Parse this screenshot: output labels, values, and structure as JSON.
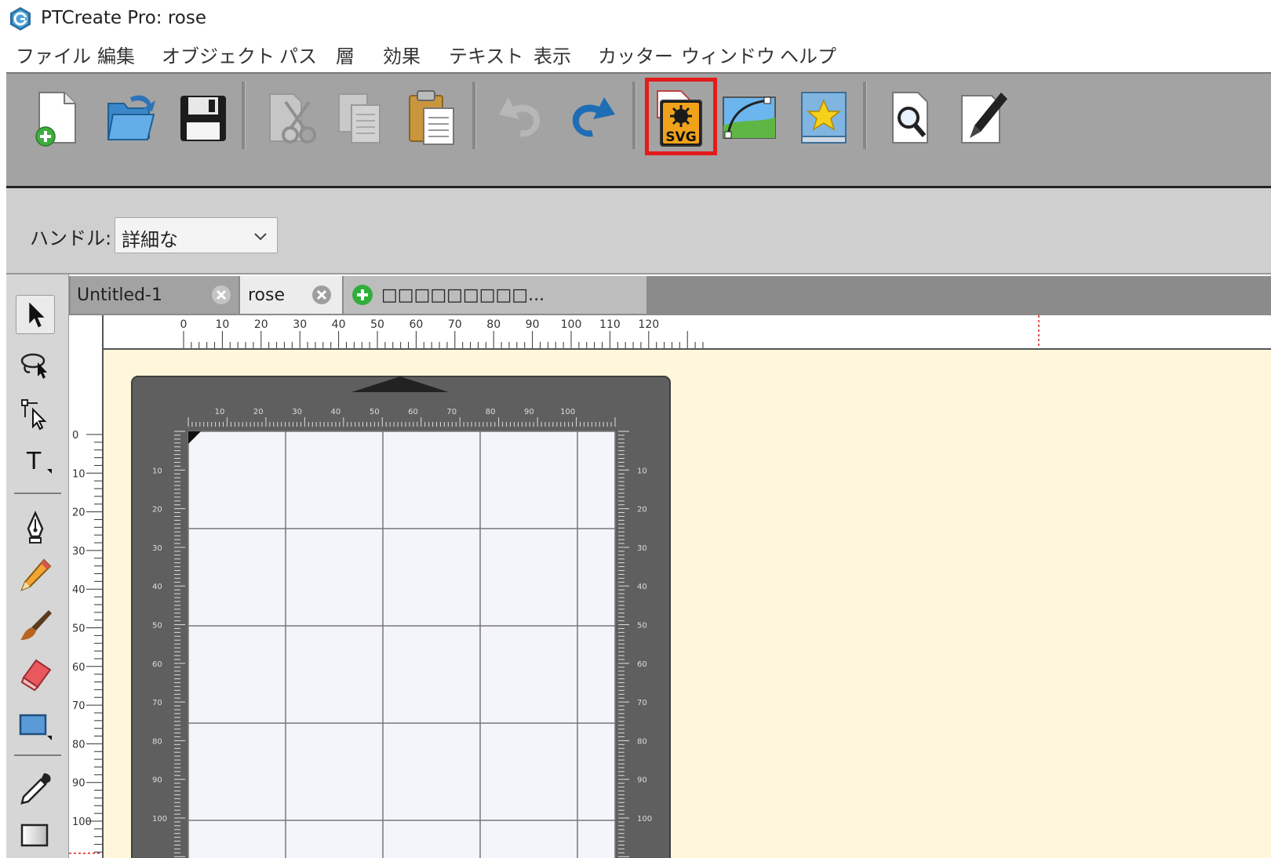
{
  "window": {
    "title": "PTCreate Pro: rose"
  },
  "menu": [
    "ファイル",
    "編集",
    "オブジェクト",
    "パス",
    "層",
    "効果",
    "テキスト",
    "表示",
    "カッター",
    "ウィンドウ",
    "ヘルプ"
  ],
  "toolbar": {
    "buttons": [
      "new-document",
      "open",
      "save",
      "cut",
      "copy",
      "paste",
      "undo",
      "redo",
      "import-svg",
      "trace-image",
      "library",
      "preview",
      "cut-to-cutter"
    ],
    "highlighted": "import-svg",
    "svg_label": "SVG"
  },
  "properties": {
    "handle_label": "ハンドル:",
    "handle_value": "詳細な"
  },
  "tabs": [
    {
      "label": "Untitled-1",
      "active": false
    },
    {
      "label": "rose",
      "active": true
    },
    {
      "label": "□□□□□□□□□...",
      "active": false
    }
  ],
  "rulers": {
    "top_labels": [
      "0",
      "10",
      "20",
      "30",
      "40",
      "50",
      "60",
      "70",
      "80",
      "90",
      "100",
      "110",
      "120"
    ],
    "left_labels": [
      "0",
      "10",
      "20",
      "30",
      "40",
      "50",
      "60",
      "70",
      "80",
      "90",
      "100"
    ]
  },
  "mat": {
    "top_labels": [
      "10",
      "20",
      "30",
      "40",
      "50",
      "60",
      "70",
      "80",
      "90",
      "100"
    ],
    "side_labels": [
      "10",
      "20",
      "30",
      "40",
      "50",
      "60",
      "70",
      "80",
      "90",
      "100"
    ]
  },
  "colors": {
    "highlight": "#e41b1b",
    "canvas": "#fff6db",
    "toolbar": "#a3a3a3",
    "mat": "#5f5f5f"
  }
}
